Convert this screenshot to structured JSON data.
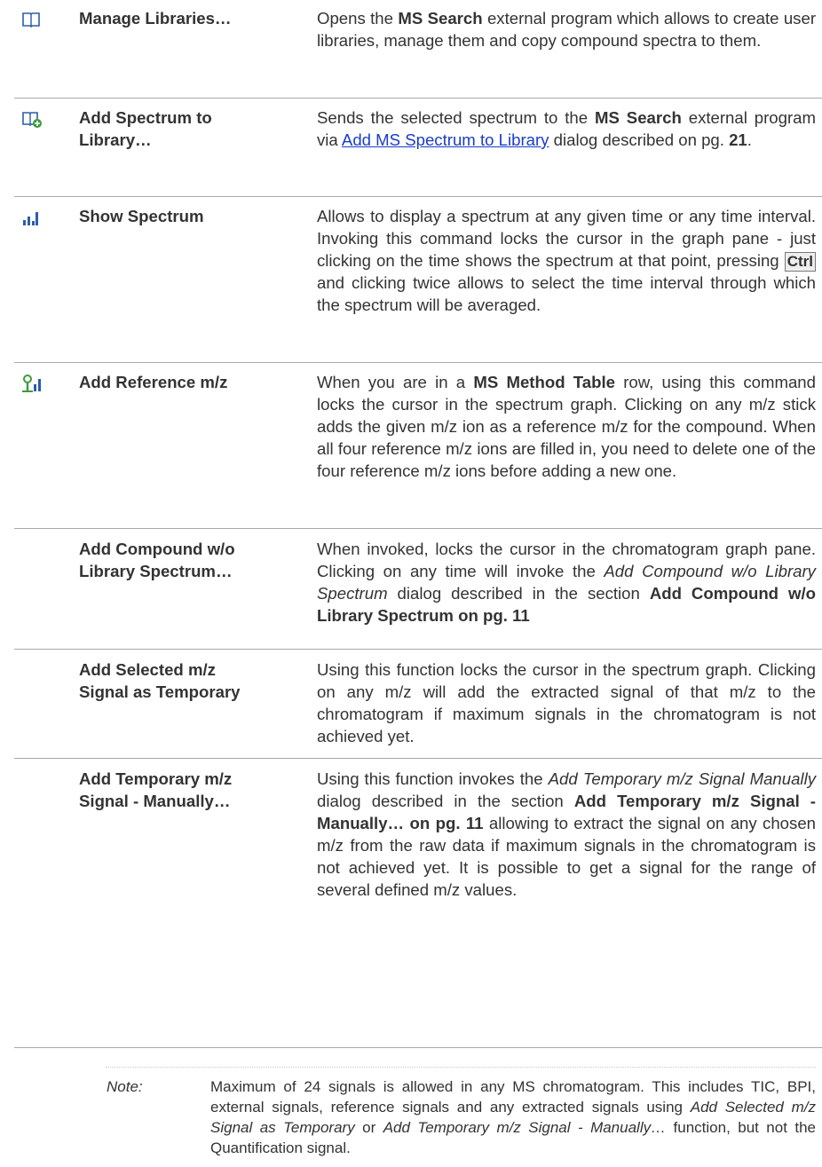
{
  "rows": [
    {
      "command": "Manage Libraries…",
      "icon": "book-icon",
      "desc": {
        "p1": "Opens the ",
        "b1": "MS Search",
        "p2": " external program which allows to create user libraries, manage them and copy compound spectra to them."
      }
    },
    {
      "command": "Add Spectrum to\nLibrary…",
      "icon": "book-add-icon",
      "desc": {
        "p1": "Sends the selected spectrum to the ",
        "b1": "MS Search",
        "p2": " external program via ",
        "link": "Add MS Spectrum to Library",
        "p3": " dialog described on pg. ",
        "b2": "21",
        "p4": "."
      }
    },
    {
      "command": "Show Spectrum",
      "icon": "spectrum-bars-icon",
      "desc": {
        "p1": "Allows to display a spectrum at any given time or any time interval. Invoking this command locks the cursor in the graph pane - just clicking on the time shows the spectrum at that point, pressing ",
        "kbd": "Ctrl",
        "p2": " and clicking twice allows to select the time interval through which the spectrum will be averaged."
      }
    },
    {
      "command": "Add Reference m/z",
      "icon": "reference-mz-icon",
      "desc": {
        "p1": "When you are in a ",
        "b1": "MS Method Table",
        "p2": " row, using this command locks the cursor in the spectrum graph. Clicking on any m/z stick adds the given m/z ion as a reference m/z for the compound. When all four reference m/z ions are filled in, you need to delete one of the four reference m/z ions before adding a new one."
      }
    },
    {
      "command": "Add Compound w/o\nLibrary Spectrum…",
      "desc": {
        "p1": "When invoked, locks the cursor in the chromatogram graph pane. Clicking on any time will invoke the ",
        "i1": "Add Compound w/o Library Spectrum",
        "p2": " dialog described in the section ",
        "b1": "Add Compound w/o Library Spectrum on pg. 11"
      }
    },
    {
      "command": "Add Selected m/z\nSignal as Temporary",
      "desc": {
        "p1": "Using this function locks the cursor in the spectrum graph. Clicking on any m/z will add the extracted signal of that m/z to the chromatogram if maximum signals in the chromatogram is not achieved yet."
      }
    },
    {
      "command": "Add Temporary m/z\nSignal - Manually…",
      "desc": {
        "p1": "Using this function invokes the ",
        "i1": "Add Temporary m/z Signal Manually",
        "p2": " dialog described in the section ",
        "b1": "Add Temporary m/z Signal - Manually… on pg. 11",
        "p3": " allowing to extract the signal on any chosen m/z from the raw data if maximum signals in the chromatogram is not achieved yet. It is possible to get a signal for the range of several defined m/z values."
      }
    }
  ],
  "note": {
    "label": "Note:",
    "p1": "Maximum of 24 signals is allowed in any MS chromatogram. This includes TIC, BPI, external signals, reference signals and any extracted signals using ",
    "i1": "Add Selected m/z Signal as Temporary",
    "p2": " or ",
    "i2": "Add Temporary m/z Signal - Manually…",
    "p3": " function, but not the Quantification signal."
  },
  "colors": {
    "link": "#1a3cc8",
    "text": "#333333",
    "divider": "#a9a9a9",
    "icon_blue": "#2b5ea8",
    "icon_green": "#3c9a3c"
  }
}
